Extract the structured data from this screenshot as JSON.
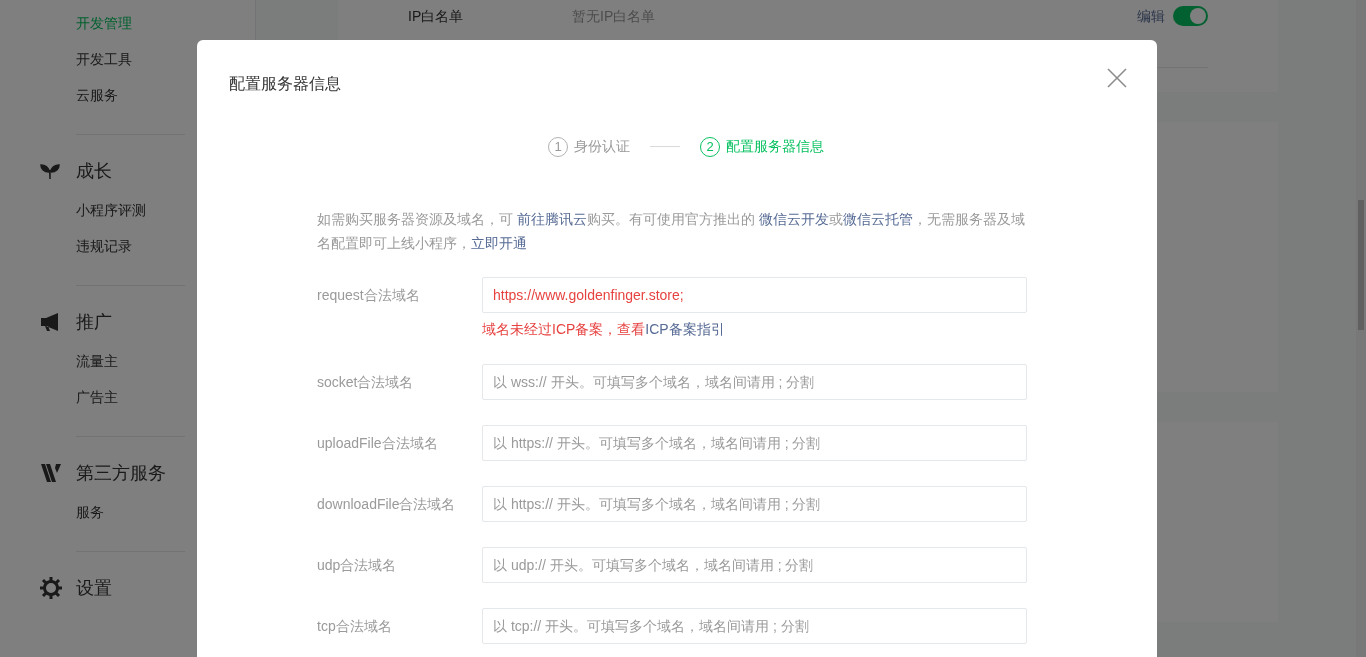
{
  "sidebar": {
    "sections": [
      {
        "items": [
          {
            "label": "开发管理",
            "selected": true
          },
          {
            "label": "开发工具",
            "selected": false
          },
          {
            "label": "云服务",
            "selected": false
          }
        ]
      },
      {
        "title": "成长",
        "items": [
          {
            "label": "小程序评测",
            "selected": false
          },
          {
            "label": "违规记录",
            "selected": false
          }
        ]
      },
      {
        "title": "推广",
        "items": [
          {
            "label": "流量主",
            "selected": false
          },
          {
            "label": "广告主",
            "selected": false
          }
        ]
      },
      {
        "title": "第三方服务",
        "items": [
          {
            "label": "服务",
            "selected": false
          }
        ]
      },
      {
        "title": "设置"
      }
    ]
  },
  "background_card": {
    "label": "IP白名单",
    "value": "暂无IP白名单",
    "edit_link": "编辑",
    "toggle": {
      "on": true
    }
  },
  "dialog": {
    "title": "配置服务器信息",
    "steps": [
      {
        "number": "1",
        "label": "身份认证",
        "selected": false
      },
      {
        "number": "2",
        "label": "配置服务器信息",
        "selected": true
      }
    ],
    "intro": [
      {
        "kind": "text",
        "text": "如需购买服务器资源及域名，可 "
      },
      {
        "kind": "link",
        "text": "前往腾讯云"
      },
      {
        "kind": "text",
        "text": "购买。有可使用官方推出的 "
      },
      {
        "kind": "link",
        "text": "微信云开发"
      },
      {
        "kind": "text",
        "text": "或"
      },
      {
        "kind": "link",
        "text": "微信云托管"
      },
      {
        "kind": "text",
        "text": "，无需服务器及域名配置即可上线小程序，"
      },
      {
        "kind": "link",
        "text": "立即开通"
      }
    ],
    "fields": [
      {
        "label": "request合法域名",
        "value": "https://www.goldenfinger.store;",
        "error": "域名未经过ICP备案，查看",
        "error_link": "ICP备案指引"
      },
      {
        "label": "socket合法域名",
        "placeholder": "以 wss:// 开头。可填写多个域名，域名间请用 ; 分割"
      },
      {
        "label": "uploadFile合法域名",
        "placeholder": "以 https:// 开头。可填写多个域名，域名间请用 ; 分割"
      },
      {
        "label": "downloadFile合法域名",
        "placeholder": "以 https:// 开头。可填写多个域名，域名间请用 ; 分割"
      },
      {
        "label": "udp合法域名",
        "placeholder": "以 udp:// 开头。可填写多个域名，域名间请用 ; 分割"
      },
      {
        "label": "tcp合法域名",
        "placeholder": "以 tcp:// 开头。可填写多个域名，域名间请用 ; 分割"
      }
    ]
  }
}
